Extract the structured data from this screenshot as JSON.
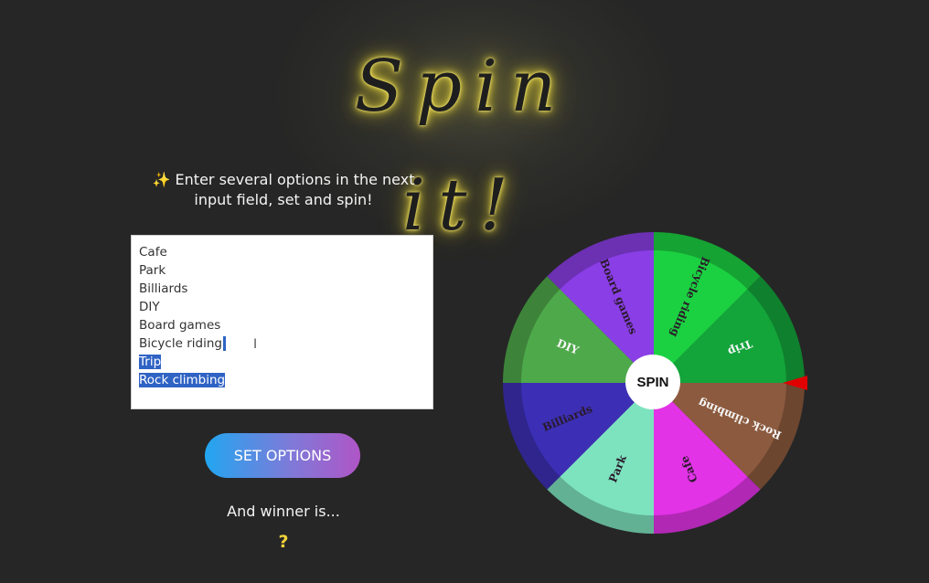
{
  "app": {
    "title": "Spin it!",
    "intro_icon": "✨",
    "intro_text": "Enter several options in the next input field, set and spin!"
  },
  "options": [
    {
      "label": "Cafe",
      "selected": false
    },
    {
      "label": "Park",
      "selected": false
    },
    {
      "label": "Billiards",
      "selected": false
    },
    {
      "label": "DIY",
      "selected": false
    },
    {
      "label": "Board games",
      "selected": false
    },
    {
      "label": "Bicycle riding",
      "selected": false
    },
    {
      "label": "Trip",
      "selected": true
    },
    {
      "label": "Rock climbing",
      "selected": true
    }
  ],
  "buttons": {
    "set_options": "SET OPTIONS",
    "spin": "SPIN"
  },
  "result": {
    "label": "And winner is...",
    "value": "?"
  },
  "wheel": {
    "segments": [
      {
        "label": "Cafe",
        "color": "#e233e6"
      },
      {
        "label": "Park",
        "color": "#7de3bf"
      },
      {
        "label": "Billiards",
        "color": "#3c2fb5"
      },
      {
        "label": "DIY",
        "color": "#4ea94a"
      },
      {
        "label": "Board games",
        "color": "#8a3ee6"
      },
      {
        "label": "Bicycle riding",
        "color": "#1bd141"
      },
      {
        "label": "Trip",
        "color": "#13a43a"
      },
      {
        "label": "Rock climbing",
        "color": "#8c5a3e"
      }
    ],
    "pointer_color": "#e00000"
  }
}
